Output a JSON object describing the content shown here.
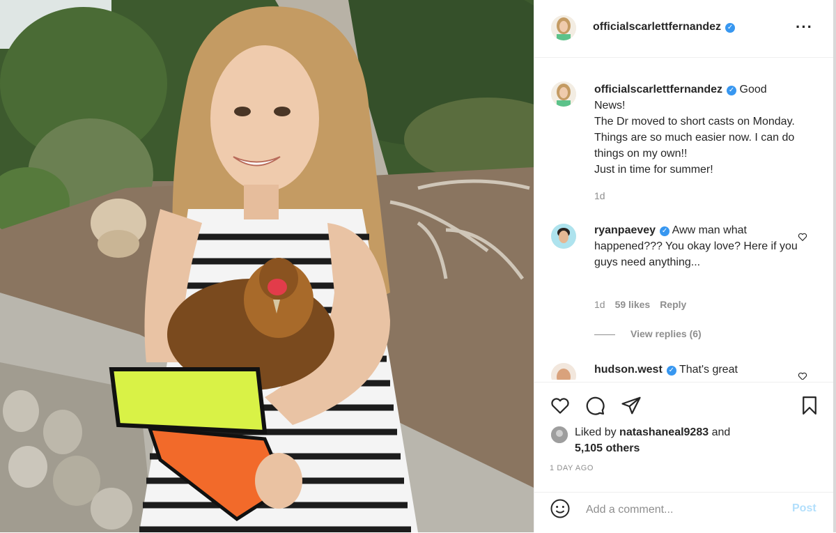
{
  "post": {
    "author": {
      "username": "officialscarlettfernandez",
      "verified_icon": "verified-badge-icon"
    },
    "more_icon": "more-options-icon",
    "caption": {
      "username": "officialscarlettfernandez",
      "text_line1": "Good",
      "text_body": "News!\nThe Dr moved to short casts on Monday. Things are so much easier now. I can do things on my own!!\nJust in time for summer!",
      "time": "1d"
    },
    "comments": [
      {
        "username": "ryanpaevey",
        "text": "Aww man what happened??? You okay love? Here if you guys need anything...",
        "time": "1d",
        "likes": "59 likes",
        "reply": "Reply",
        "view_replies": "View replies (6)"
      },
      {
        "username": "hudson.west",
        "text": "That's great"
      }
    ],
    "actions": {
      "icons": [
        "heart-icon",
        "comment-icon",
        "share-icon",
        "bookmark-icon"
      ]
    },
    "likes": {
      "prefix": "Liked by",
      "user": "natashaneal9283",
      "connector": "and",
      "others": "5,105 others"
    },
    "timestamp": "1 DAY AGO",
    "add_comment": {
      "placeholder": "Add a comment...",
      "post_label": "Post",
      "emoji_icon": "emoji-icon"
    },
    "colors": {
      "verified": "#3897f0",
      "secondary_text": "#8e8e8e",
      "post_disabled": "#b2dffc",
      "primary_text": "#262626"
    }
  }
}
